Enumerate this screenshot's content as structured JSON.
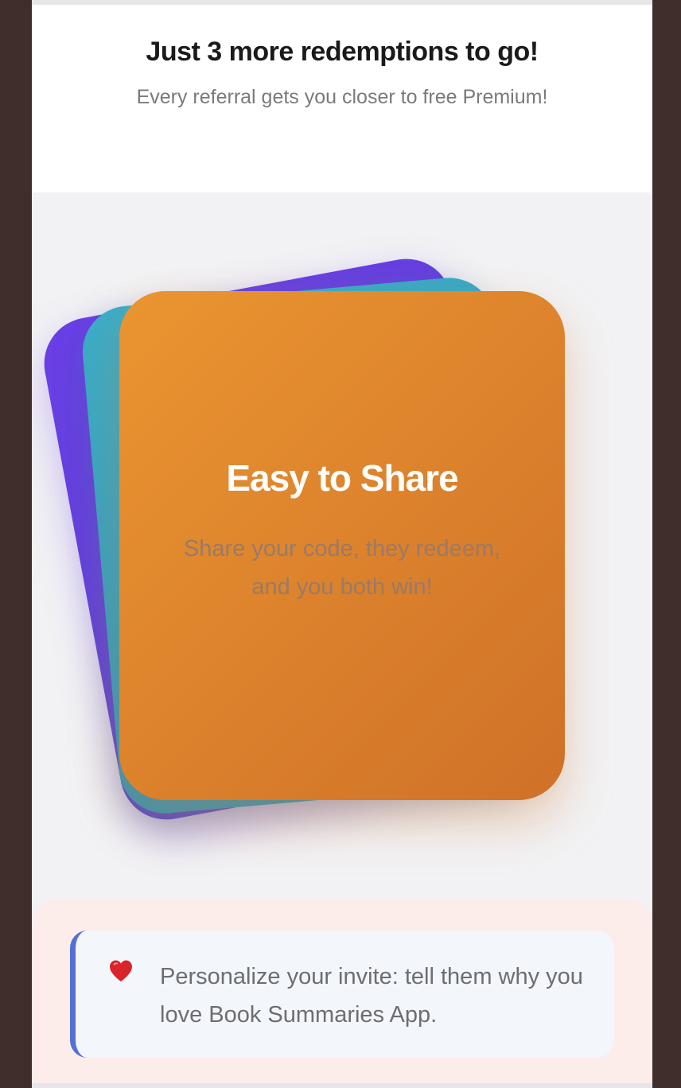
{
  "header": {
    "title": "Just 3 more redemptions to go!",
    "subtitle": "Every referral gets you closer to free Premium!"
  },
  "cards": {
    "front": {
      "title": "Easy to Share",
      "text": "Share your code, they redeem, and you both win!"
    },
    "colors": {
      "purple": "#6a3fe6",
      "teal": "#3aaec8",
      "orange": "#ea9531"
    }
  },
  "tip": {
    "icon": "heart-icon",
    "text": "Personalize your invite: tell them why you love Book Summaries App."
  }
}
